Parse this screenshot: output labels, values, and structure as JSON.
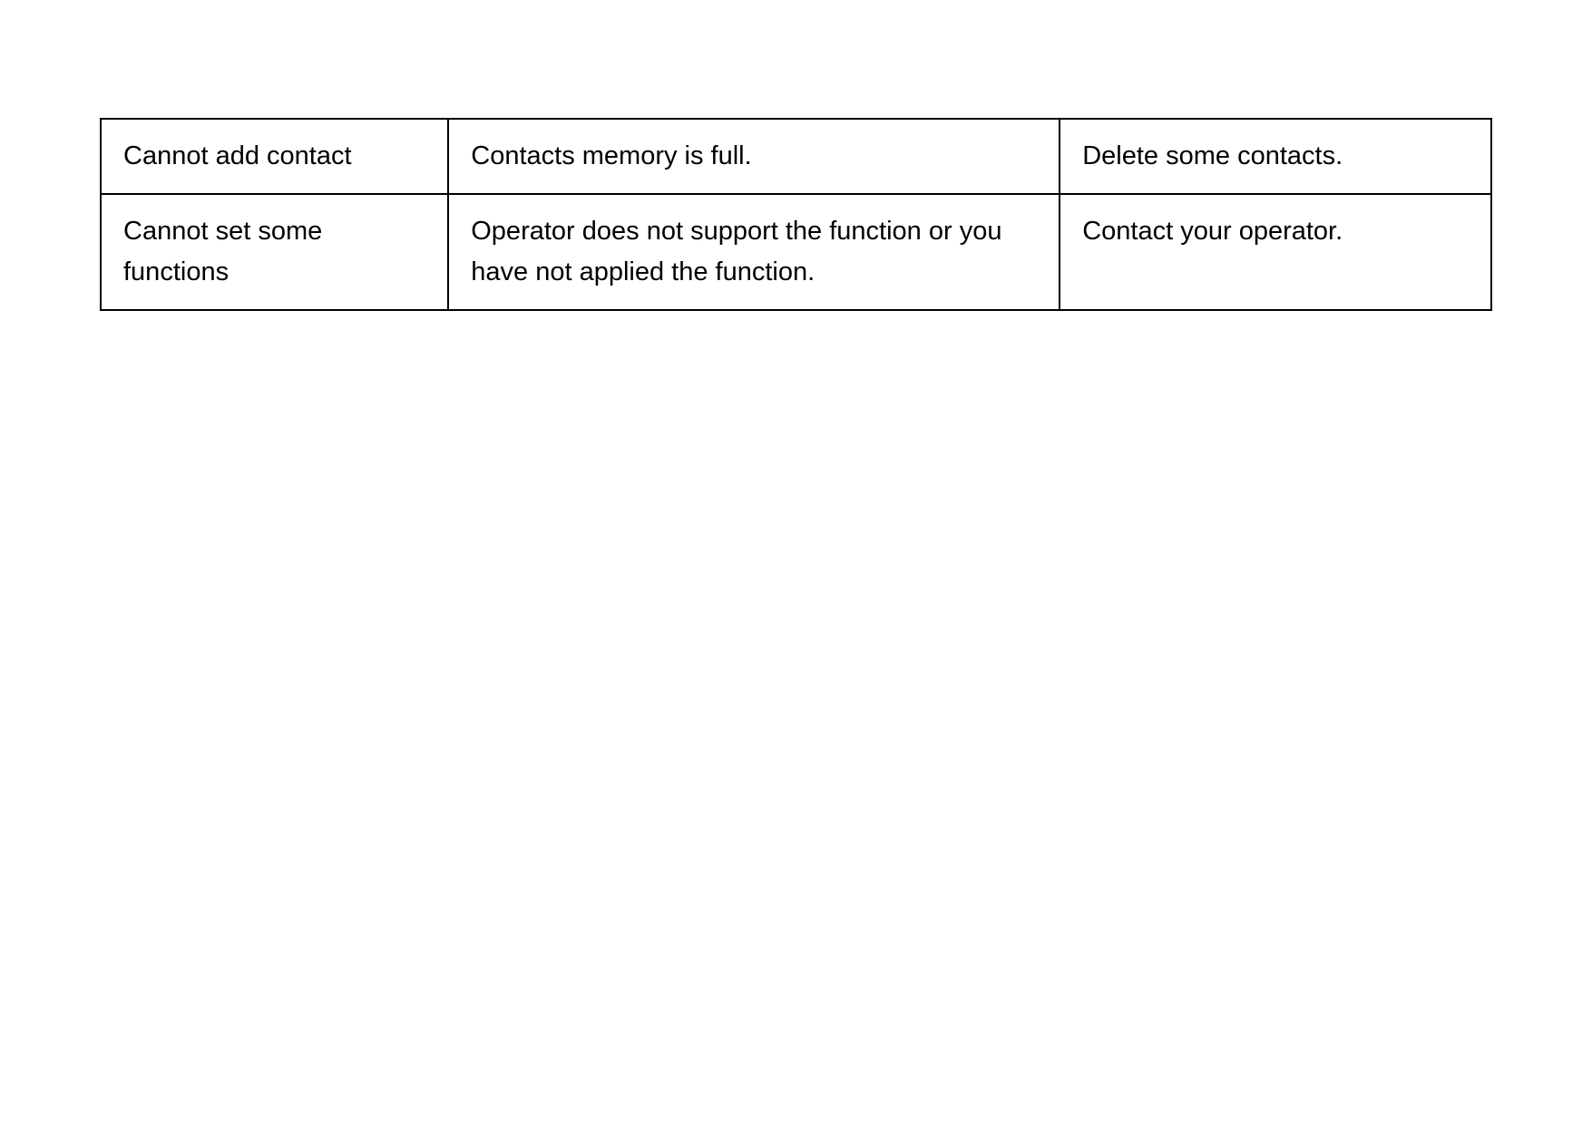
{
  "table": {
    "rows": [
      {
        "problem": "Cannot add contact",
        "cause": "Contacts memory is full.",
        "solution": "Delete some contacts."
      },
      {
        "problem": "Cannot set some functions",
        "cause": "Operator does not support the function or you have not applied the function.",
        "solution": "Contact your operator."
      }
    ]
  }
}
